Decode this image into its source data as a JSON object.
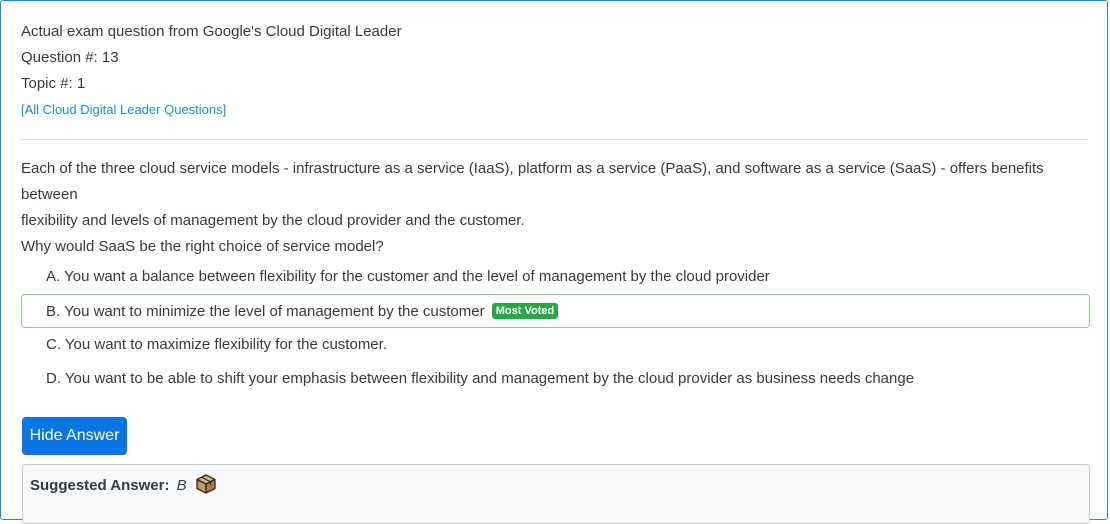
{
  "header": {
    "title": "Actual exam question from Google's Cloud Digital Leader",
    "question_number": "Question #: 13",
    "topic": "Topic #: 1",
    "all_questions_link": "[All Cloud Digital Leader Questions]"
  },
  "question": {
    "text_line1": "Each of the three cloud service models - infrastructure as a service (IaaS), platform as a service (PaaS), and software as a service (SaaS) - offers benefits between",
    "text_line2": "flexibility and levels of management by the cloud provider and the customer.",
    "text_line3": "Why would SaaS be the right choice of service model?"
  },
  "choices": [
    {
      "letter": "A.",
      "text": "You want a balance between flexibility for the customer and the level of management by the cloud provider"
    },
    {
      "letter": "B.",
      "text": "You want to minimize the level of management by the customer",
      "badge": "Most Voted"
    },
    {
      "letter": "C.",
      "text": "You want to maximize flexibility for the customer."
    },
    {
      "letter": "D.",
      "text": "You want to be able to shift your emphasis between flexibility and management by the cloud provider as business needs change"
    }
  ],
  "actions": {
    "hide_answer_label": "Hide Answer"
  },
  "answer": {
    "label": "Suggested Answer:",
    "value": "B",
    "icon": "box-icon"
  },
  "colors": {
    "border_accent": "#1e8ad8",
    "link": "#1e8ad8",
    "button": "#0b74e6",
    "most_voted_badge": "#28a745",
    "voted_border": "#8bd18b"
  }
}
